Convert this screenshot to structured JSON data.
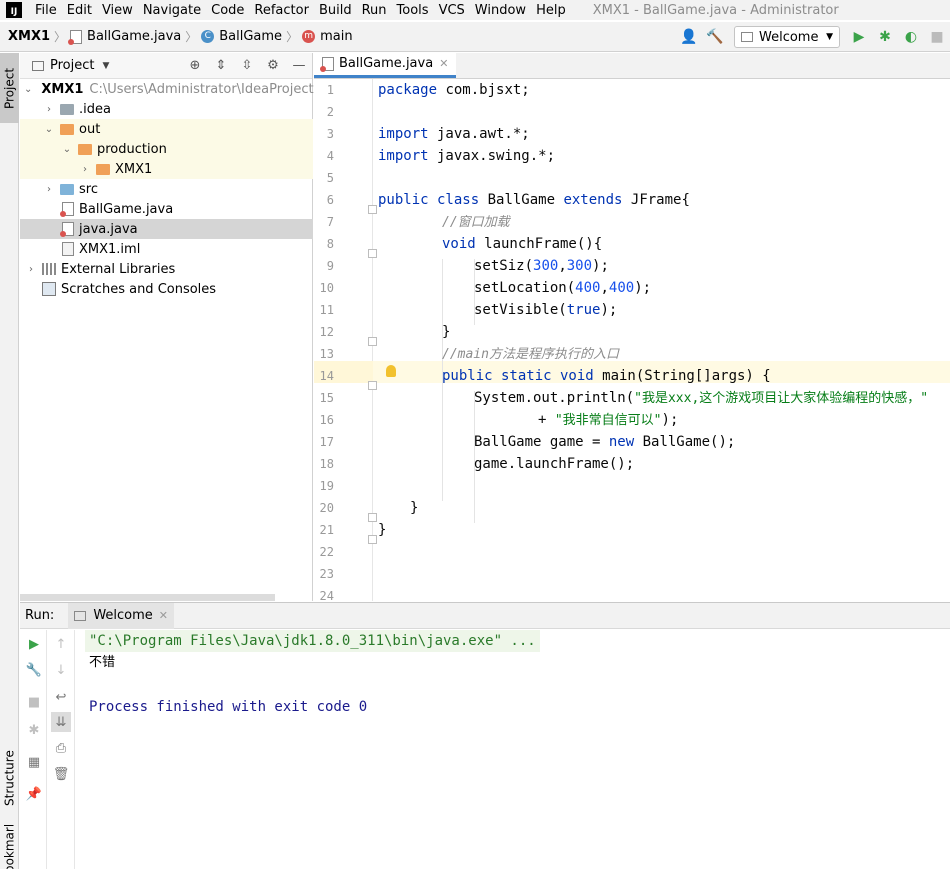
{
  "menubar": {
    "items": [
      "File",
      "Edit",
      "View",
      "Navigate",
      "Code",
      "Refactor",
      "Build",
      "Run",
      "Tools",
      "VCS",
      "Window",
      "Help"
    ],
    "window_title": "XMX1 - BallGame.java - Administrator"
  },
  "navbar": {
    "project": "XMX1",
    "file": "BallGame.java",
    "class": "BallGame",
    "method": "main",
    "run_config": "Welcome"
  },
  "stripe": {
    "project": "Project",
    "structure": "Structure",
    "bookmarks": "Bookmarks"
  },
  "project_panel": {
    "title": "Project",
    "tree": {
      "root": "XMX1",
      "root_path": "C:\\Users\\Administrator\\IdeaProjects",
      "idea": ".idea",
      "out": "out",
      "production": "production",
      "xmx1": "XMX1",
      "src": "src",
      "ballgame": "BallGame.java",
      "java": "java.java",
      "iml": "XMX1.iml",
      "libs": "External Libraries",
      "scratches": "Scratches and Consoles"
    }
  },
  "editor": {
    "tab": "BallGame.java",
    "line_numbers": [
      "1",
      "2",
      "3",
      "4",
      "5",
      "6",
      "7",
      "8",
      "9",
      "10",
      "11",
      "12",
      "13",
      "14",
      "15",
      "16",
      "17",
      "18",
      "19",
      "20",
      "21",
      "22",
      "23",
      "24"
    ],
    "code": {
      "l1a": "package",
      "l1b": " com.bjsxt;",
      "l3a": "import",
      "l3b": " java.awt.*;",
      "l4a": "import",
      "l4b": " javax.swing.*;",
      "l6a": "public class",
      "l6b": " BallGame ",
      "l6c": "extends",
      "l6d": " JFrame{",
      "l7": "//窗口加载",
      "l8a": "void",
      "l8b": " launchFrame(){",
      "l9a": "setSiz(",
      "l9b": "300",
      "l9c": ",",
      "l9d": "300",
      "l9e": ");",
      "l10a": "setLocation(",
      "l10b": "400",
      "l10c": ",",
      "l10d": "400",
      "l10e": ");",
      "l11a": "setVisible(",
      "l11b": "true",
      "l11c": ");",
      "l12": "}",
      "l13": "//main方法是程序执行的入口",
      "l14a": "public static void",
      "l14b": " main(String[]args) {",
      "l15a": "System.out.println(",
      "l15b": "\"我是xxx,这个游戏项目让大家体验编程的快感，\"",
      "l16a": "+ ",
      "l16b": "\"我非常自信可以\"",
      "l16c": ");",
      "l17a": "BallGame game = ",
      "l17b": "new",
      "l17c": " BallGame();",
      "l18": "game.launchFrame();",
      "l20": "}",
      "l21": "}"
    }
  },
  "run_panel": {
    "label": "Run:",
    "tab": "Welcome",
    "console": {
      "cmd": "\"C:\\Program Files\\Java\\jdk1.8.0_311\\bin\\java.exe\" ...",
      "output": "不错",
      "exit": "Process finished with exit code 0"
    }
  }
}
